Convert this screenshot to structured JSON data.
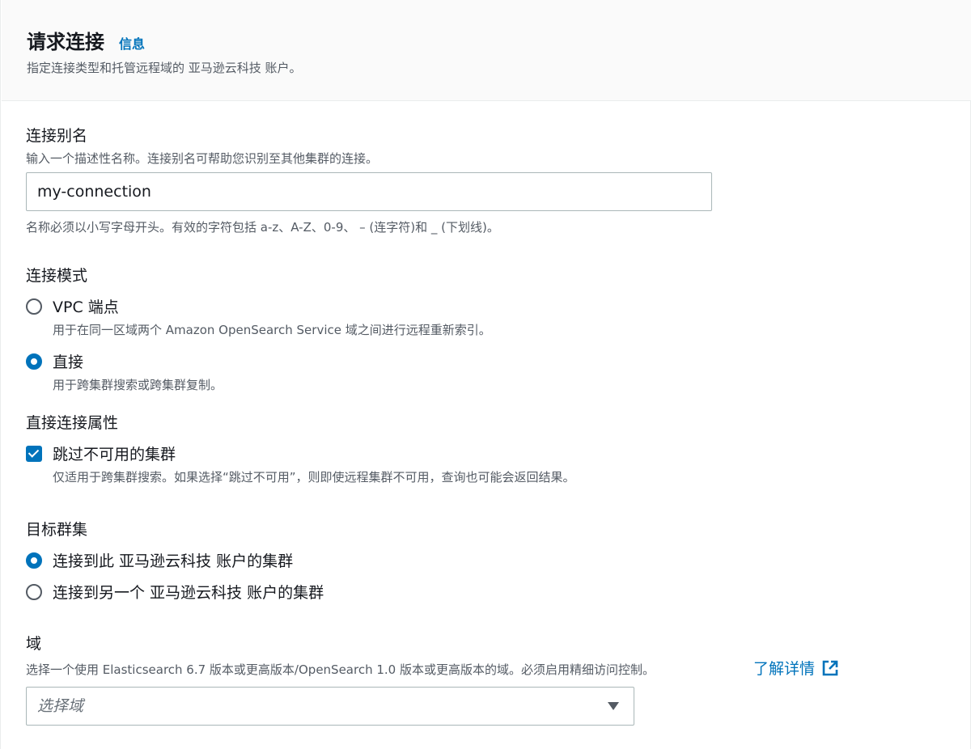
{
  "header": {
    "title": "请求连接",
    "info_link": "信息",
    "description": "指定连接类型和托管远程域的 亚马逊云科技 账户。"
  },
  "alias": {
    "label": "连接别名",
    "description": "输入一个描述性名称。连接别名可帮助您识别至其他集群的连接。",
    "value": "my-connection",
    "constraint": "名称必须以小写字母开头。有效的字符包括 a-z、A-Z、0-9、 – (连字符)和 _ (下划线)。"
  },
  "mode": {
    "label": "连接模式",
    "options": [
      {
        "label": "VPC 端点",
        "description": "用于在同一区域两个 Amazon OpenSearch Service 域之间进行远程重新索引。",
        "selected": false
      },
      {
        "label": "直接",
        "description": "用于跨集群搜索或跨集群复制。",
        "selected": true
      }
    ]
  },
  "direct_props": {
    "label": "直接连接属性",
    "skip_unavailable": {
      "label": "跳过不可用的集群",
      "description": "仅适用于跨集群搜索。如果选择“跳过不可用”，则即使远程集群不可用，查询也可能会返回结果。",
      "checked": true
    }
  },
  "target": {
    "label": "目标群集",
    "options": [
      {
        "label": "连接到此 亚马逊云科技 账户的集群",
        "selected": true
      },
      {
        "label": "连接到另一个 亚马逊云科技 账户的集群",
        "selected": false
      }
    ]
  },
  "domain": {
    "label": "域",
    "description": "选择一个使用 Elasticsearch 6.7 版本或更高版本/OpenSearch 1.0 版本或更高版本的域。必须启用精细访问控制。",
    "learn_more": "了解详情",
    "placeholder": "选择域"
  },
  "colors": {
    "accent": "#0073bb",
    "text": "#16191f",
    "secondary": "#545b64"
  },
  "icons": {
    "external": "external-link-icon",
    "caret": "caret-down-icon"
  }
}
